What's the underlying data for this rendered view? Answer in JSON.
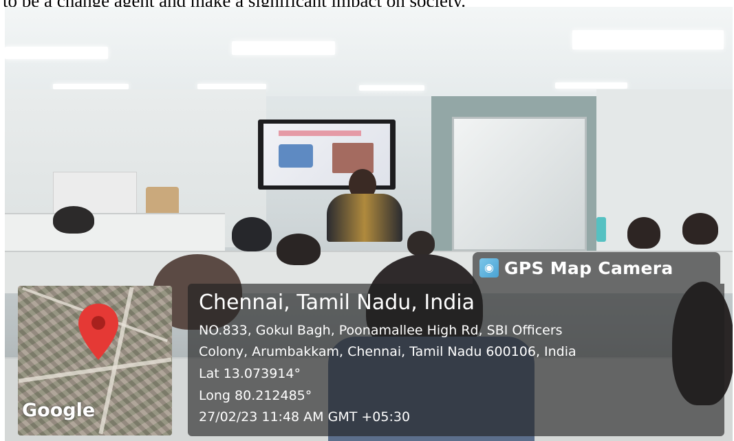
{
  "top_caption": "to be a change agent and make a significant impact on society.",
  "overlay": {
    "app_name": "GPS Map Camera",
    "place": "Chennai, Tamil Nadu, India",
    "address_line1": "NO.833, Gokul Bagh, Poonamallee High Rd, SBI Officers",
    "address_line2": "Colony, Arumbakkam, Chennai, Tamil Nadu 600106, India",
    "lat": "Lat 13.073914°",
    "long": "Long 80.212485°",
    "datetime": "27/02/23 11:48 AM GMT +05:30",
    "map_brand": "Google",
    "pin_color": "#e53935",
    "logo_icon": "camera-map-icon"
  }
}
